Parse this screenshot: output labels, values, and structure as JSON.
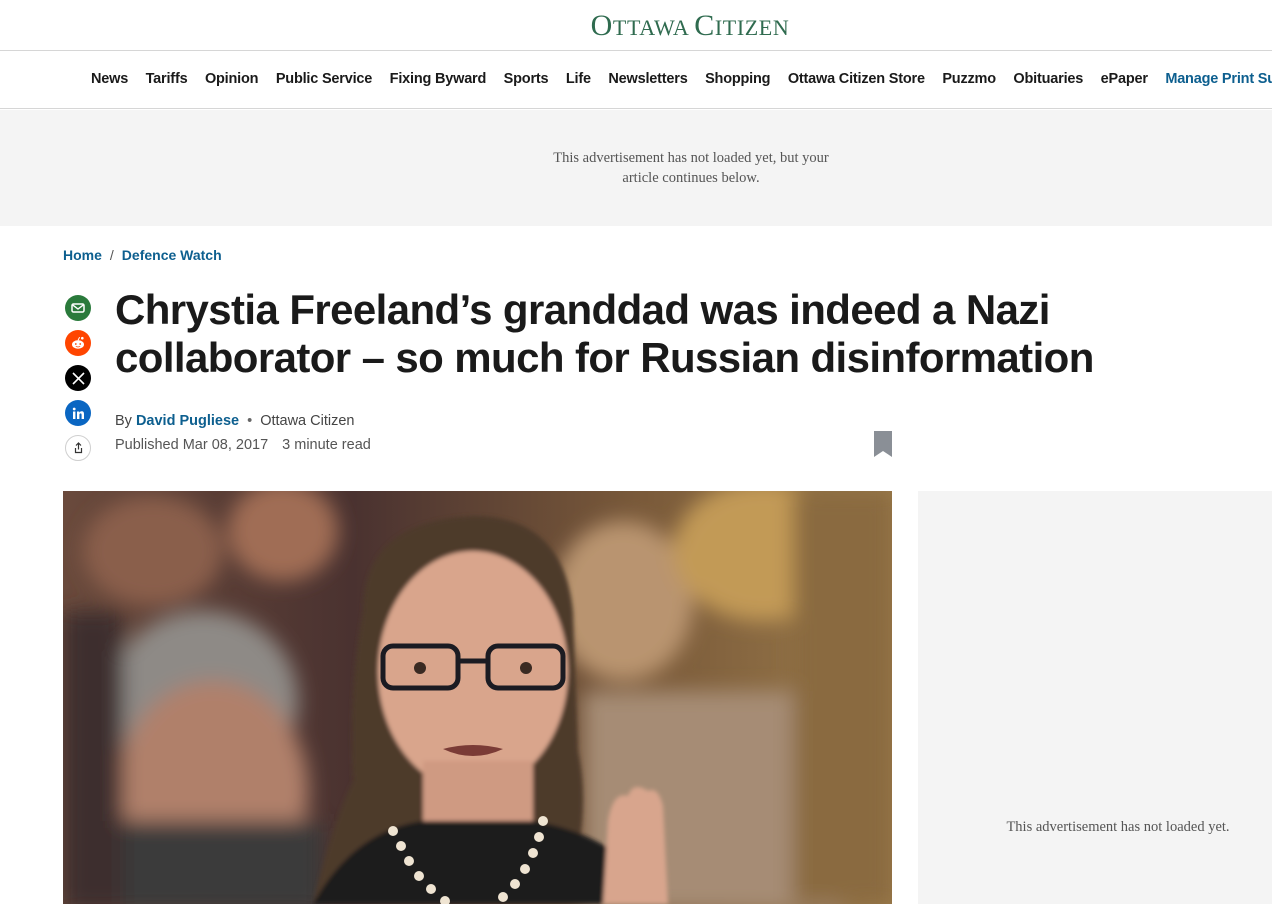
{
  "masthead": {
    "logo_text": "Ottawa Citizen"
  },
  "nav": {
    "items": [
      {
        "label": "News"
      },
      {
        "label": "Tariffs"
      },
      {
        "label": "Opinion"
      },
      {
        "label": "Public Service"
      },
      {
        "label": "Fixing Byward"
      },
      {
        "label": "Sports"
      },
      {
        "label": "Life"
      },
      {
        "label": "Newsletters"
      },
      {
        "label": "Shopping"
      },
      {
        "label": "Ottawa Citizen Store"
      },
      {
        "label": "Puzzmo"
      },
      {
        "label": "Obituaries"
      },
      {
        "label": "ePaper"
      },
      {
        "label": "Manage Print Subscript"
      }
    ],
    "accent_color": "#0d5f8f"
  },
  "ad_top": {
    "text": "This advertisement has not loaded yet, but your article continues below."
  },
  "breadcrumb": {
    "home": "Home",
    "separator": "/",
    "section": "Defence Watch"
  },
  "share": {
    "icons": [
      "email-icon",
      "reddit-icon",
      "x-icon",
      "linkedin-icon",
      "share-icon"
    ]
  },
  "article": {
    "headline": "Chrystia Freeland’s granddad was indeed a Nazi collaborator – so much for Russian disinformation",
    "by_prefix": "By",
    "author": "David Pugliese",
    "byline_separator": "•",
    "publication": "Ottawa Citizen",
    "published": "Published Mar 08, 2017",
    "read_time": "3 minute read"
  },
  "ad_side": {
    "text": "This advertisement has not loaded yet."
  },
  "colors": {
    "brand_green": "#2f6b4f",
    "link_blue": "#0d5f8f",
    "ad_background": "#f4f4f4"
  }
}
